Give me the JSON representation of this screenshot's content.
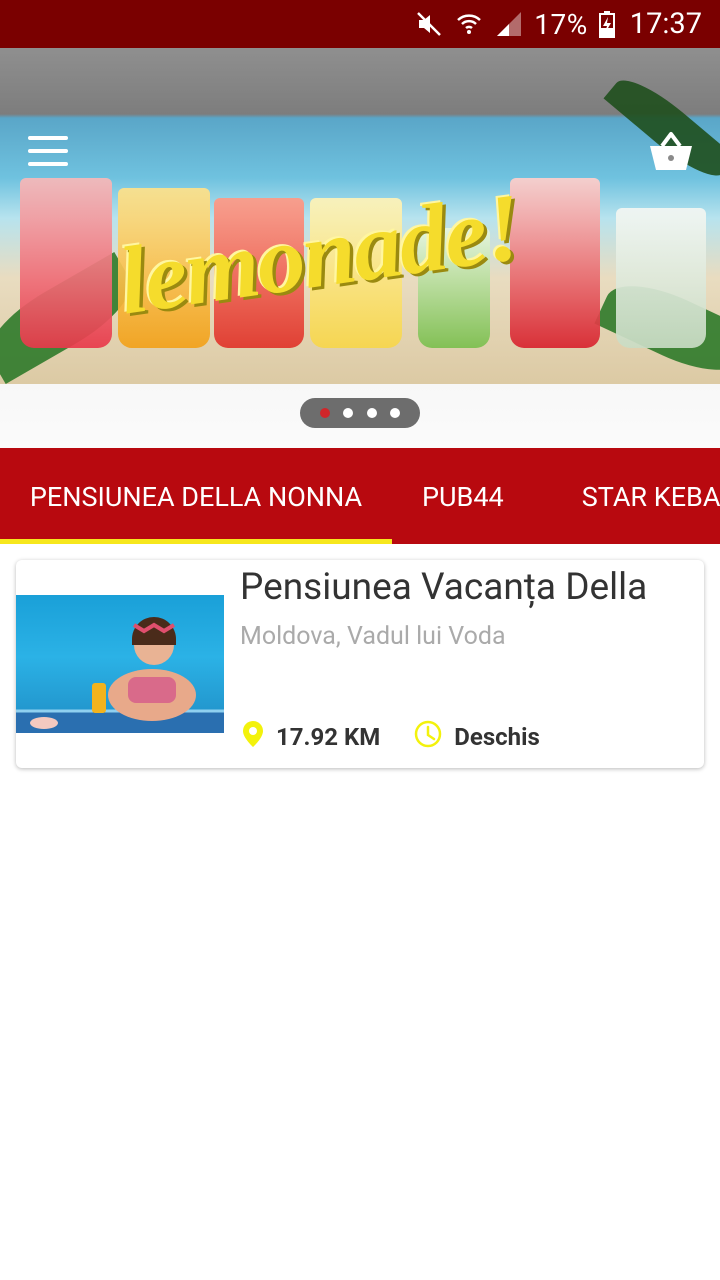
{
  "status_bar": {
    "battery_percent": "17%",
    "time": "17:37",
    "icons": [
      "mute-icon",
      "wifi-icon",
      "signal-icon",
      "battery-charging-icon"
    ]
  },
  "banner": {
    "text": "lemonade!",
    "menu_icon": "hamburger-menu-icon",
    "cart_icon": "basket-icon",
    "pager": {
      "count": 4,
      "active_index": 0
    }
  },
  "tabs": [
    {
      "label": "PENSIUNEA DELLA NONNA",
      "selected": true
    },
    {
      "label": "PUB44",
      "selected": false
    },
    {
      "label": "STAR KEBAB",
      "selected": false
    }
  ],
  "listing": {
    "title": "Pensiunea Vacanța Della",
    "location": "Moldova, Vadul lui Voda",
    "distance": "17.92 KM",
    "status": "Deschis"
  },
  "colors": {
    "status_bar": "#7a0000",
    "tab_bar": "#b8090f",
    "tab_indicator": "#f6e71d",
    "icon_accent": "#f3f20c"
  }
}
